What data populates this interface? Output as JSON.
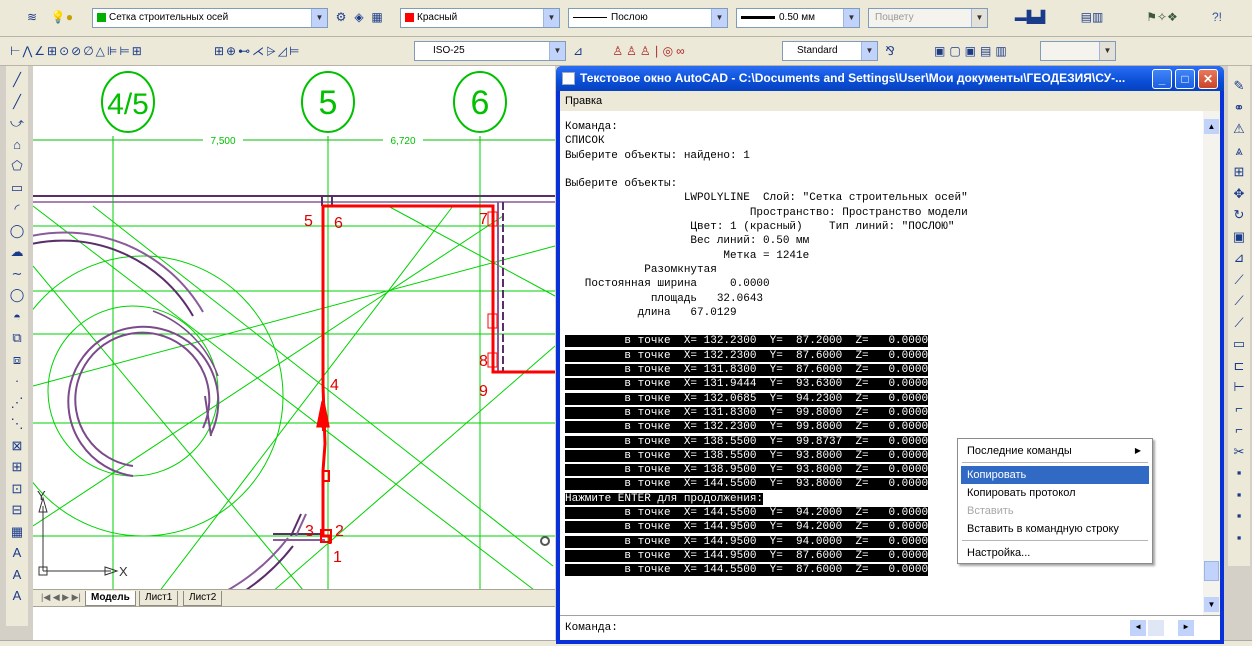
{
  "toolbar1": {
    "layer": "Сетка строительных осей",
    "color": "Красный",
    "color_hex": "#ff0000",
    "linetype": "Послою",
    "lineweight": "0.50 мм",
    "plotstyle": "Поцвету"
  },
  "toolbar2": {
    "dimstyle": "ISO-25",
    "textstyle": "Standard"
  },
  "drawing": {
    "axes": [
      "4/5",
      "5",
      "6"
    ],
    "dims": [
      "7,500",
      "6,720"
    ],
    "vertex_labels": [
      "1",
      "2",
      "3",
      "4",
      "5",
      "6",
      "7",
      "8",
      "9"
    ],
    "ucs_x": "X",
    "ucs_y": "Y",
    "colors": {
      "grid": "#00d200",
      "poly": "#ff0000",
      "wall": "#6b3a7a",
      "axis_text": "#00c000"
    }
  },
  "tabs": [
    {
      "label": "Модель",
      "active": true
    },
    {
      "label": "Лист1",
      "active": false
    },
    {
      "label": "Лист2",
      "active": false
    }
  ],
  "textwin": {
    "title": "Текстовое окно AutoCAD - C:\\Documents and Settings\\User\\Мои документы\\ГЕОДЕЗИЯ\\СУ-...",
    "menu": "Правка",
    "lines": [
      "Команда:",
      "СПИСОК",
      "Выберите объекты: найдено: 1",
      "",
      "Выберите объекты:",
      "                  LWPOLYLINE  Слой: \"Сетка строительных осей\"",
      "                            Пространство: Пространство модели",
      "                   Цвет: 1 (красный)    Тип линий: \"ПОСЛОЮ\"",
      "                   Вес линий: 0.50 мм",
      "                        Метка = 1241е",
      "            Разомкнутая",
      "   Постоянная ширина     0.0000",
      "             площадь   32.0643",
      "           длина   67.0129",
      ""
    ],
    "points_a": [
      "         в точке  X= 132.2300  Y=  87.2000  Z=   0.0000",
      "         в точке  X= 132.2300  Y=  87.6000  Z=   0.0000",
      "         в точке  X= 131.8300  Y=  87.6000  Z=   0.0000",
      "         в точке  X= 131.9444  Y=  93.6300  Z=   0.0000",
      "         в точке  X= 132.0685  Y=  94.2300  Z=   0.0000",
      "         в точке  X= 131.8300  Y=  99.8000  Z=   0.0000",
      "         в точке  X= 132.2300  Y=  99.8000  Z=   0.0000",
      "         в точке  X= 138.5500  Y=  99.8737  Z=   0.0000",
      "         в точке  X= 138.5500  Y=  93.8000  Z=   0.0000",
      "         в точке  X= 138.9500  Y=  93.8000  Z=   0.0000",
      "         в точке  X= 144.5500  Y=  93.8000  Z=   0.0000"
    ],
    "prompt": "Нажмите ENTER для продолжения:",
    "points_b": [
      "         в точке  X= 144.5500  Y=  94.2000  Z=   0.0000",
      "         в точке  X= 144.9500  Y=  94.2000  Z=   0.0000",
      "         в точке  X= 144.9500  Y=  94.0000  Z=   0.0000",
      "         в точке  X= 144.9500  Y=  87.6000  Z=   0.0000",
      "         в точке  X= 144.5500  Y=  87.6000  Z=   0.0000"
    ],
    "input_label": "Команда:"
  },
  "context_menu": {
    "recent": "Последние команды",
    "copy": "Копировать",
    "copy_history": "Копировать протокол",
    "paste": "Вставить",
    "paste_cmd": "Вставить в командную строку",
    "options": "Настройка..."
  }
}
